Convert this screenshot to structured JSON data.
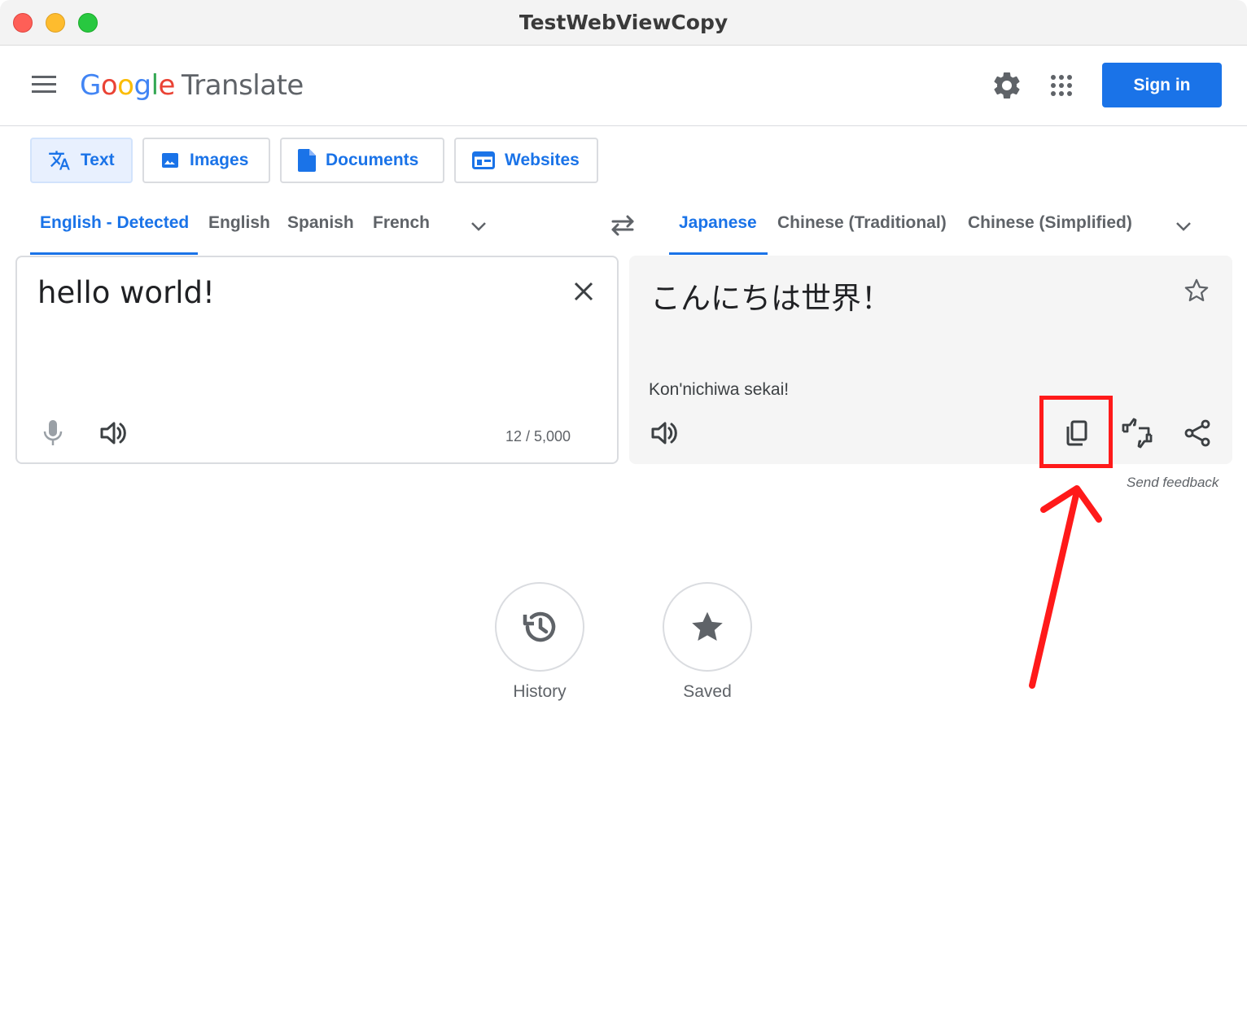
{
  "window": {
    "title": "TestWebViewCopy"
  },
  "header": {
    "logo_letters": [
      "G",
      "o",
      "o",
      "g",
      "l",
      "e"
    ],
    "logo_product": "Translate",
    "sign_in_label": "Sign in"
  },
  "modes": [
    {
      "label": "Text",
      "active": true
    },
    {
      "label": "Images",
      "active": false
    },
    {
      "label": "Documents",
      "active": false
    },
    {
      "label": "Websites",
      "active": false
    }
  ],
  "source_languages": [
    {
      "label": "English - Detected",
      "active": true
    },
    {
      "label": "English",
      "active": false
    },
    {
      "label": "Spanish",
      "active": false
    },
    {
      "label": "French",
      "active": false
    }
  ],
  "target_languages": [
    {
      "label": "Japanese",
      "active": true
    },
    {
      "label": "Chinese (Traditional)",
      "active": false
    },
    {
      "label": "Chinese (Simplified)",
      "active": false
    }
  ],
  "source": {
    "text": "hello world!",
    "char_count": "12 / 5,000"
  },
  "target": {
    "text": "こんにちは世界！",
    "romanization": "Kon'nichiwa sekai!"
  },
  "feedback_label": "Send feedback",
  "bottom": {
    "history_label": "History",
    "saved_label": "Saved"
  },
  "colors": {
    "accent": "#1a73e8",
    "annotation": "#ff1a1a"
  },
  "icons": [
    "menu-icon",
    "gear-icon",
    "apps-grid-icon",
    "translate-icon",
    "image-icon",
    "document-icon",
    "website-icon",
    "chevron-down-icon",
    "swap-icon",
    "close-icon",
    "microphone-icon",
    "speaker-icon",
    "star-outline-icon",
    "copy-icon",
    "rate-icon",
    "share-icon",
    "history-icon",
    "star-icon"
  ]
}
